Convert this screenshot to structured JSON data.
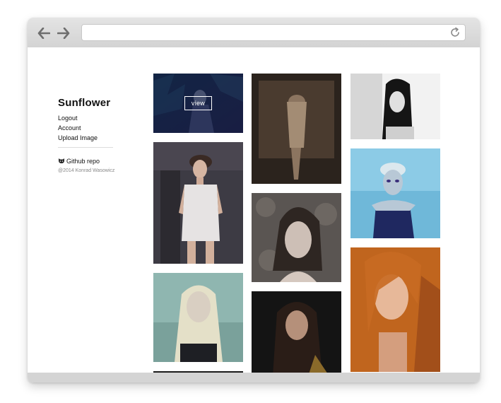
{
  "browser": {
    "back_icon": "arrow-left-icon",
    "forward_icon": "arrow-right-icon",
    "reload_icon": "reload-icon",
    "address_value": ""
  },
  "sidebar": {
    "brand": "Sunflower",
    "links": [
      "Logout",
      "Account",
      "Upload Image"
    ],
    "github_label": "Github repo",
    "github_icon": "github-octocat-icon",
    "copyright": "@2014 Konrad Wasowicz"
  },
  "gallery": {
    "hover_button_label": "view",
    "accent": "#1e2560"
  }
}
